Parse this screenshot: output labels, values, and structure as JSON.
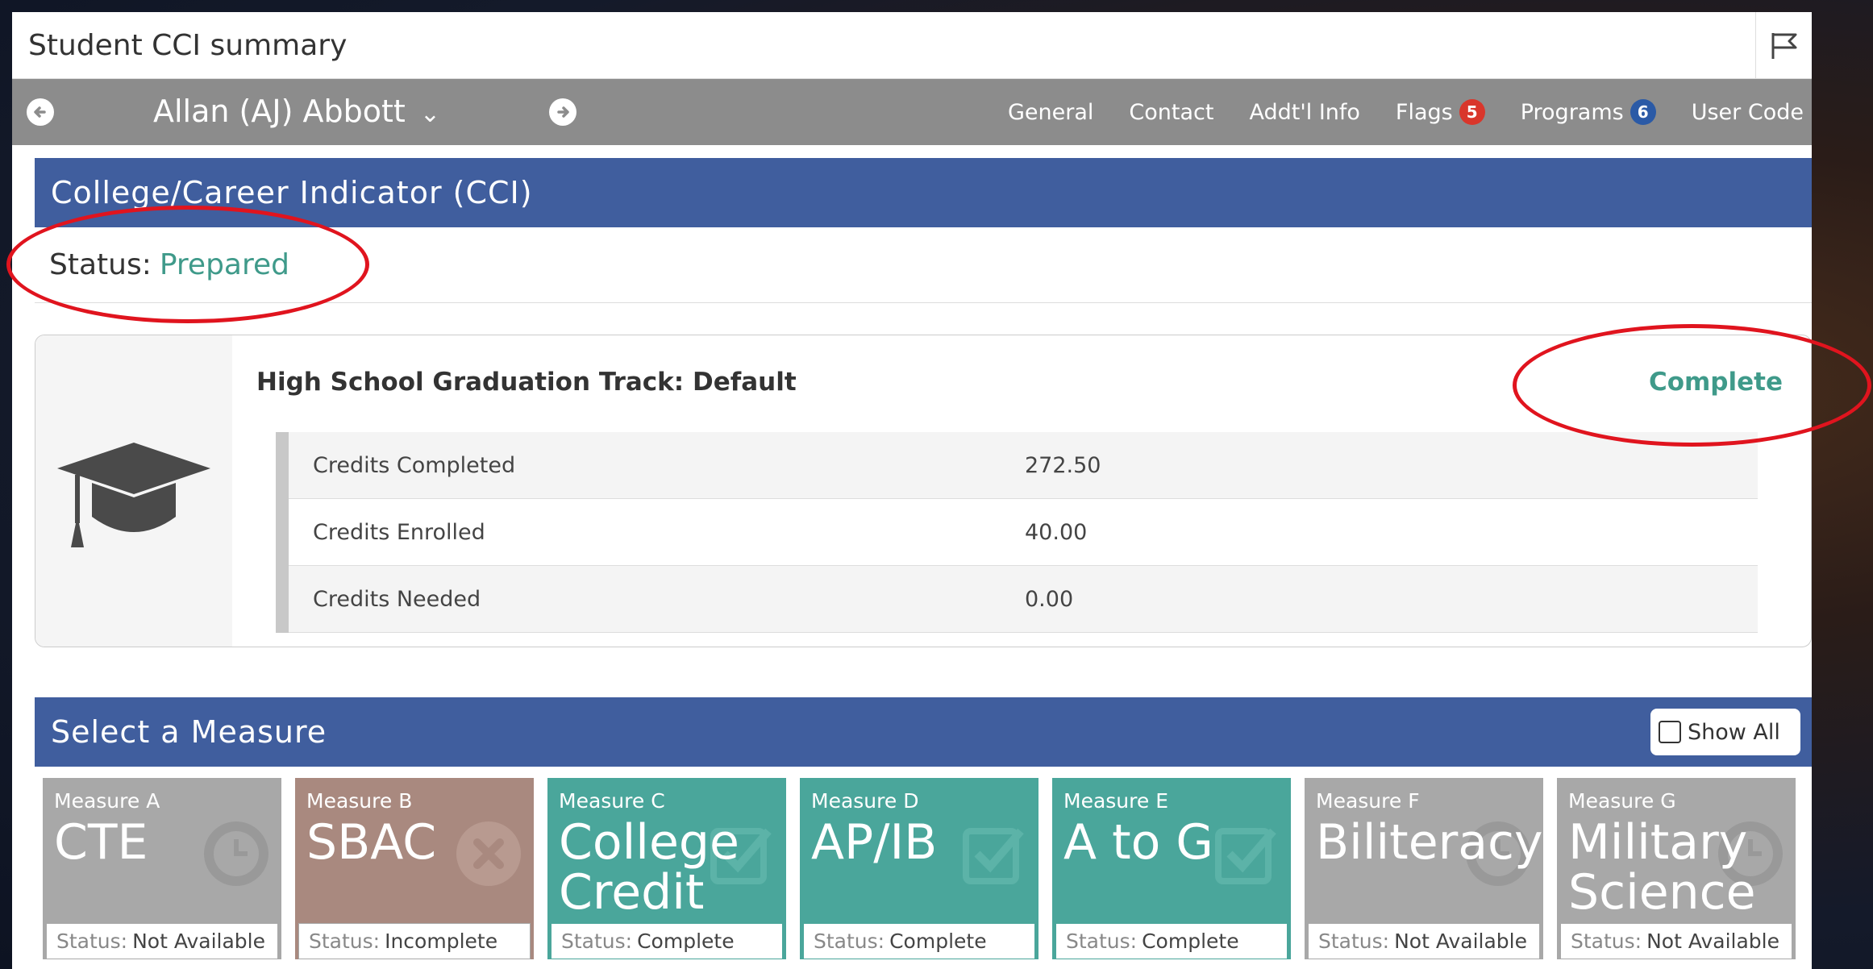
{
  "window": {
    "title": "Student CCI summary"
  },
  "student": {
    "name": "Allan (AJ) Abbott",
    "caret": "⌄"
  },
  "nav": {
    "items": [
      {
        "label": "General"
      },
      {
        "label": "Contact"
      },
      {
        "label": "Addt'l Info"
      },
      {
        "label": "Flags",
        "badge": "5",
        "badge_color": "#d9362b"
      },
      {
        "label": "Programs",
        "badge": "6",
        "badge_color": "#2b5aa6"
      },
      {
        "label": "User Code"
      }
    ]
  },
  "cci": {
    "header": "College/Career Indicator (CCI)",
    "status_label": "Status:",
    "status_value": "Prepared"
  },
  "grad": {
    "track_title": "High School Graduation Track: Default",
    "track_status": "Complete",
    "rows": [
      {
        "label": "Credits Completed",
        "value": "272.50"
      },
      {
        "label": "Credits Enrolled",
        "value": "40.00"
      },
      {
        "label": "Credits Needed",
        "value": "0.00"
      }
    ]
  },
  "measures_section": {
    "header": "Select a Measure",
    "show_all_label": "Show All"
  },
  "measures": [
    {
      "label": "Measure A",
      "name": "CTE",
      "status_label": "Status:",
      "status": "Not Available",
      "icon": "clock-icon",
      "color": "#a8a8a8"
    },
    {
      "label": "Measure B",
      "name": "SBAC",
      "status_label": "Status:",
      "status": "Incomplete",
      "icon": "x-circle-icon",
      "color": "#a9897f"
    },
    {
      "label": "Measure C",
      "name": "College Credit",
      "status_label": "Status:",
      "status": "Complete",
      "icon": "check-icon",
      "color": "#4aa69b"
    },
    {
      "label": "Measure D",
      "name": "AP/IB",
      "status_label": "Status:",
      "status": "Complete",
      "icon": "check-icon",
      "color": "#4aa69b"
    },
    {
      "label": "Measure E",
      "name": "A to G",
      "status_label": "Status:",
      "status": "Complete",
      "icon": "check-icon",
      "color": "#4aa69b"
    },
    {
      "label": "Measure F",
      "name": "Biliteracy",
      "status_label": "Status:",
      "status": "Not Available",
      "icon": "clock-icon",
      "color": "#a8a8a8"
    },
    {
      "label": "Measure G",
      "name": "Military Science",
      "status_label": "Status:",
      "status": "Not Available",
      "icon": "clock-icon",
      "color": "#a8a8a8"
    }
  ],
  "colors": {
    "accent": "#405e9e",
    "success": "#3f9a8a",
    "annotation": "#e0141e"
  }
}
